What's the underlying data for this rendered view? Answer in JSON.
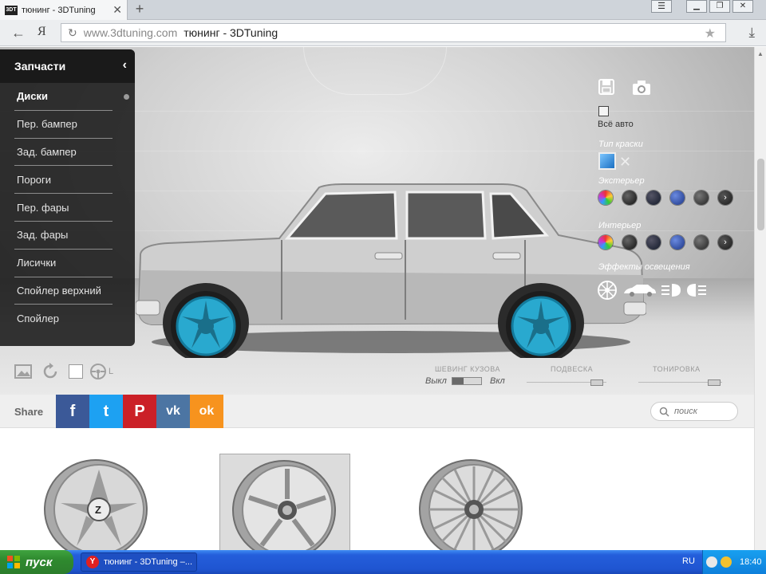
{
  "browser": {
    "tab_title": "тюнинг - 3DTuning",
    "tab_favicon_text": "3DT",
    "close_glyph": "✕",
    "newtab_glyph": "+",
    "back_glyph": "←",
    "yandex_glyph": "Я",
    "reload_glyph": "↻",
    "url_domain": "www.3dtuning.com",
    "url_title": "тюнинг - 3DTuning",
    "star_glyph": "★",
    "download_glyph": "⤓",
    "menu_glyph": "☰",
    "minimize_glyph": "▁",
    "restore_glyph": "❐",
    "close_window_glyph": "✕"
  },
  "parts_panel": {
    "title": "Запчасти",
    "collapse_glyph": "‹",
    "items": [
      {
        "label": "Диски"
      },
      {
        "label": "Пер. бампер"
      },
      {
        "label": "Зад. бампер"
      },
      {
        "label": "Пороги"
      },
      {
        "label": "Пер. фары"
      },
      {
        "label": "Зад. фары"
      },
      {
        "label": "Лисички"
      },
      {
        "label": "Спойлер верхний"
      },
      {
        "label": "Спойлер"
      }
    ],
    "active_index": 0
  },
  "paint_panel": {
    "all_cars_label": "Всё авто",
    "paint_type_label": "Тип краски",
    "exterior_label": "Экстерьер",
    "interior_label": "Интерьер",
    "lighting_label": "Эффекты освещения",
    "matte_glyph": "✕",
    "swatches": [
      "#7b4d9c",
      "#1c1c1c",
      "#1f2a4a",
      "#2a4aa0",
      "#3a3a3a",
      "#2a2a2a"
    ],
    "accent": "#1e9bd6"
  },
  "stage_controls": {
    "label_l": "L",
    "lowering_label": "Шевинг кузова",
    "toggle_off": "Выкл",
    "toggle_on": "Вкл",
    "suspension_label": "Подвеска",
    "tint_label": "Тонировка"
  },
  "share": {
    "label": "Share",
    "buttons": [
      {
        "name": "facebook",
        "glyph": "f",
        "color": "#3b5998"
      },
      {
        "name": "twitter",
        "glyph": "t",
        "color": "#1da1f2"
      },
      {
        "name": "pinterest",
        "glyph": "P",
        "color": "#cb2027"
      },
      {
        "name": "vk",
        "glyph": "vk",
        "color": "#4c75a3"
      },
      {
        "name": "odnoklassniki",
        "glyph": "ok",
        "color": "#f7931e"
      }
    ],
    "search_placeholder": "поиск"
  },
  "taskbar": {
    "start_label": "пуск",
    "task_label": "тюнинг - 3DTuning –...",
    "task_icon_glyph": "Y",
    "lang": "RU",
    "clock": "18:40"
  }
}
